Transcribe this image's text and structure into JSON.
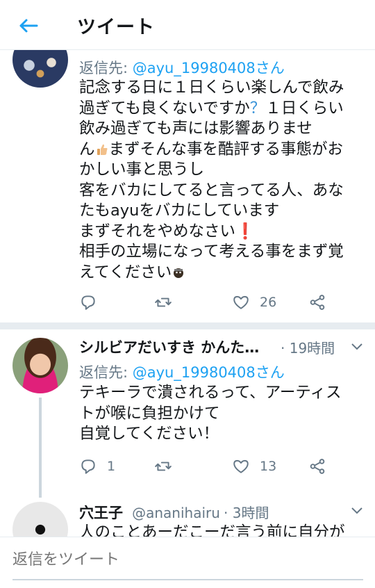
{
  "header": {
    "title": "ツイート"
  },
  "tweet1": {
    "reply_prefix": "返信先: ",
    "reply_handle": "@ayu_19980408さん",
    "lines": [
      "記念する日に１日くらい楽しんで飲み",
      "過ぎても良くないですか",
      "１日くらい",
      "飲み過ぎても声には影響ありませ",
      "ん",
      "まずそんな事を酷評する事態がお",
      "かしい事と思うし",
      "客をバカにしてると言ってる人、あな",
      "たもayuをバカにしています",
      "まずそれをやめなさい",
      "相手の立場になって考える事をまず覚",
      "えてください"
    ],
    "like_count": "26"
  },
  "tweet2": {
    "name": "シルビアだいすき かんた…",
    "time": "· 19時間",
    "reply_prefix": "返信先: ",
    "reply_handle": "@ayu_19980408さん",
    "lines": [
      "テキーラで潰されるって、アーティス",
      "トが喉に負担かけて",
      "自覚してください！"
    ],
    "reply_count": "1",
    "like_count": "13"
  },
  "tweet3": {
    "name": "穴王子",
    "handle": "@ananihairu",
    "time": "· 3時間",
    "line": "人のことあーだこーだ言う前に自分が"
  },
  "reply_bar": {
    "placeholder": "返信をツイート"
  },
  "colors": {
    "accent": "#1da1f2",
    "muted": "#657786",
    "divider": "#e6ecf0"
  }
}
